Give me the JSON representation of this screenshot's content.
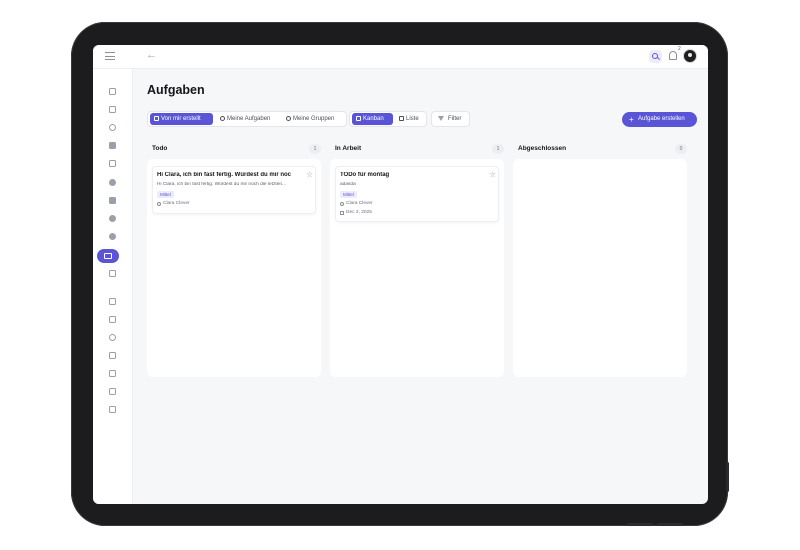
{
  "topbar": {
    "notification_count": "2"
  },
  "page": {
    "title": "Aufgaben"
  },
  "toolbar": {
    "scope_tabs": [
      {
        "label": "Von mir erstellt",
        "active": true
      },
      {
        "label": "Meine Aufgaben",
        "active": false
      },
      {
        "label": "Meine Gruppen",
        "active": false
      }
    ],
    "view_tabs": [
      {
        "label": "Kanban",
        "active": true
      },
      {
        "label": "Liste",
        "active": false
      }
    ],
    "filter_label": "Filter",
    "create_label": "Aufgabe erstellen"
  },
  "columns": [
    {
      "title": "Todo",
      "count": "1",
      "cards": [
        {
          "title": "Hi Clara, ich bin fast fertig. Würdest du mir noc",
          "description": "Hi Clara, ich bin fast fertig. Würdest du mir noch die letzten...",
          "priority": "Mittel",
          "assignee": "Clara Clever"
        }
      ]
    },
    {
      "title": "In Arbeit",
      "count": "1",
      "cards": [
        {
          "title": "TODo für montag",
          "description": "adasda",
          "priority": "Mittel",
          "assignee": "Clara Clever",
          "due": "Dec 2, 2025"
        }
      ]
    },
    {
      "title": "Abgeschlossen",
      "count": "0",
      "cards": []
    }
  ],
  "colors": {
    "accent": "#5a55d6",
    "accent_soft": "#ecebfb",
    "device_frame": "#1c1c1e",
    "background": "#f6f7f9"
  },
  "icons": {
    "sidebar": [
      "dashboard-icon",
      "news-icon",
      "graduation-icon",
      "chat-icon",
      "calendar-icon",
      "user-icon",
      "document-icon",
      "group-icon",
      "user-settings-icon",
      "kanban-icon",
      "grid-icon",
      "files-icon",
      "chart-icon",
      "award-icon",
      "calendar-alt-icon",
      "sliders-icon",
      "gallery-icon",
      "archive-icon"
    ]
  }
}
